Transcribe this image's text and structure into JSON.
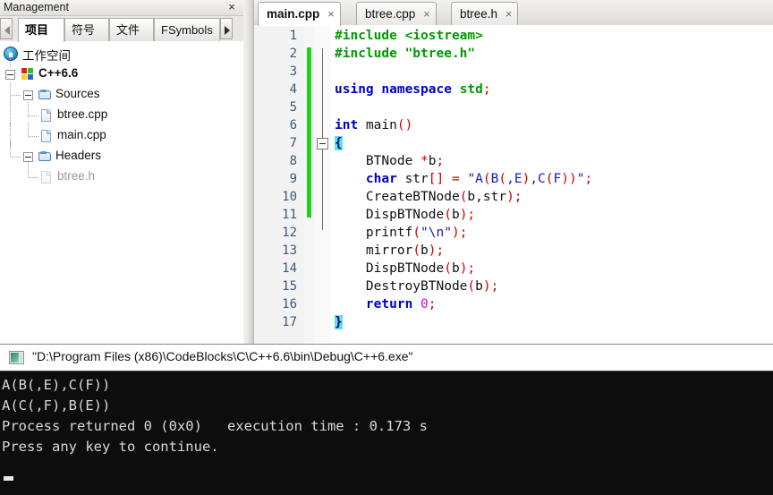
{
  "management": {
    "title": "Management",
    "close_label": "×",
    "nav_prev_icon": "triangle-left-icon",
    "nav_next_icon": "triangle-right-icon",
    "tabs": [
      {
        "label": "项目",
        "active": true
      },
      {
        "label": "符号",
        "active": false
      },
      {
        "label": "文件",
        "active": false
      },
      {
        "label": "FSymbols",
        "active": false
      }
    ],
    "tree": [
      {
        "label": "工作空间",
        "icon": "workspace-icon",
        "depth": 0,
        "bold": false,
        "dim": false,
        "expander": false
      },
      {
        "label": "C++6.6",
        "icon": "project-icon",
        "depth": 1,
        "bold": true,
        "dim": false,
        "expander": true
      },
      {
        "label": "Sources",
        "icon": "folder-icon",
        "depth": 2,
        "bold": false,
        "dim": false,
        "expander": true
      },
      {
        "label": "btree.cpp",
        "icon": "file-icon",
        "depth": 3,
        "bold": false,
        "dim": false,
        "expander": false
      },
      {
        "label": "main.cpp",
        "icon": "file-icon",
        "depth": 3,
        "bold": false,
        "dim": false,
        "expander": false
      },
      {
        "label": "Headers",
        "icon": "folder-icon",
        "depth": 2,
        "bold": false,
        "dim": false,
        "expander": true
      },
      {
        "label": "btree.h",
        "icon": "file-icon",
        "depth": 3,
        "bold": false,
        "dim": true,
        "expander": false
      }
    ]
  },
  "editor": {
    "tabs": [
      {
        "label": "main.cpp",
        "active": true,
        "close": "×"
      },
      {
        "label": "btree.cpp",
        "active": false,
        "close": "×"
      },
      {
        "label": "btree.h",
        "active": false,
        "close": "×"
      }
    ],
    "line_numbers": [
      "1",
      "2",
      "3",
      "4",
      "5",
      "6",
      "7",
      "8",
      "9",
      "10",
      "11",
      "12",
      "13",
      "14",
      "15",
      "16",
      "17"
    ],
    "lines": [
      "#include <iostream>",
      "#include \"btree.h\"",
      "",
      "using namespace std;",
      "",
      "int main()",
      "{",
      "    BTNode *b;",
      "    char str[] = \"A(B(,E),C(F))\";",
      "    CreateBTNode(b,str);",
      "    DispBTNode(b);",
      "    printf(\"\\n\");",
      "    mirror(b);",
      "    DispBTNode(b);",
      "    DestroyBTNode(b);",
      "    return 0;",
      "}"
    ],
    "fold_marker_icon": "fold-collapse-icon"
  },
  "console": {
    "icon": "console-window-icon",
    "path": "\"D:\\Program Files (x86)\\CodeBlocks\\C\\C++6.6\\bin\\Debug\\C++6.exe\"",
    "output": [
      "A(B(,E),C(F))",
      "A(C(,F),B(E))",
      "Process returned 0 (0x0)   execution time : 0.173 s",
      "Press any key to continue."
    ]
  },
  "colors": {
    "keyword": "#0000c8",
    "preprocessor": "#009a00",
    "string": "#1414c8",
    "number": "#d400d4",
    "operator": "#cc0000",
    "brace_highlight": "#55e6f0",
    "change_bar": "#19d619",
    "console_bg": "#0d0d0d",
    "console_fg": "#d8d8d8"
  }
}
